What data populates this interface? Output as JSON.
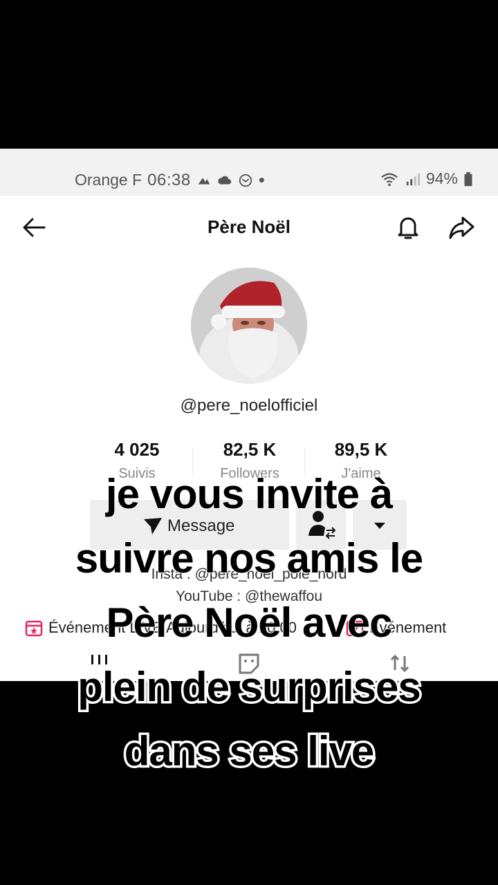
{
  "status_bar": {
    "carrier": "Orange F",
    "time": "06:38",
    "battery": "94%"
  },
  "header": {
    "title": "Père Noël"
  },
  "profile": {
    "handle": "@pere_noelofficiel",
    "stats": [
      {
        "value": "4 025",
        "label": "Suivis"
      },
      {
        "value": "82,5 K",
        "label": "Followers"
      },
      {
        "value": "89,5 K",
        "label": "J'aime"
      }
    ],
    "message_button": "Message",
    "bio_lines": [
      "Insta : @pere_noel_pole_nord",
      "YouTube : @thewaffou"
    ],
    "event_left": "Événement LIVE Aujourd'hui à 10:00",
    "event_right": "Événement"
  },
  "caption": {
    "lines": [
      "je vous invite à",
      "suivre nos amis le",
      "Père Noël avec",
      "plein de surprises",
      "dans ses live"
    ]
  },
  "colors": {
    "accent": "#e6245f",
    "background": "#000000",
    "status_bar": "#f2f2f2"
  }
}
